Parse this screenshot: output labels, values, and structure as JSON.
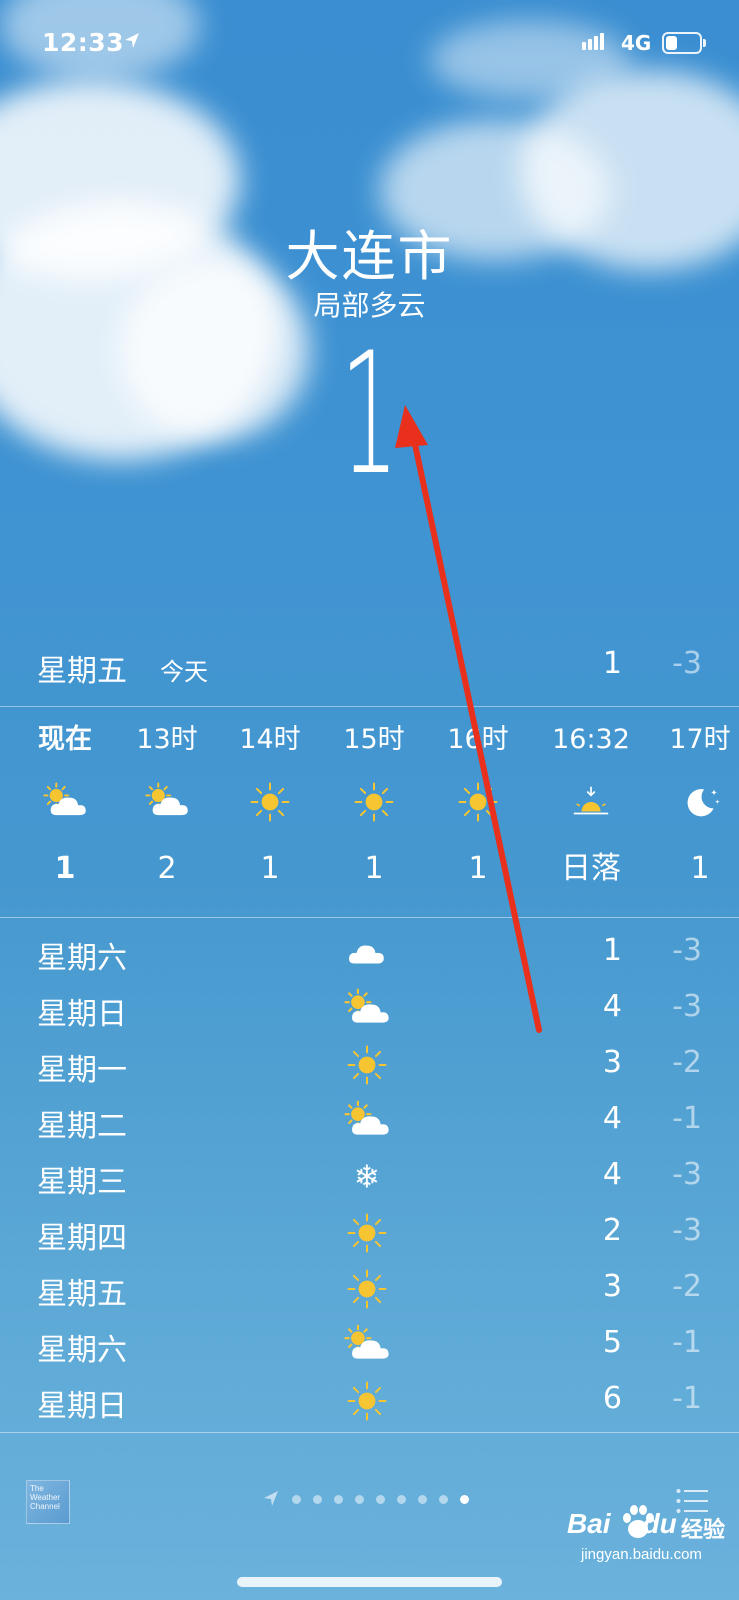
{
  "status_bar": {
    "time": "12:33",
    "network": "4G",
    "battery_level": 0.35
  },
  "location": {
    "city": "大连市",
    "condition": "局部多云",
    "temperature": "1"
  },
  "today": {
    "day": "星期五",
    "label": "今天",
    "high": "1",
    "low": "-3"
  },
  "hourly": [
    {
      "time": "现在",
      "icon": "partly-cloudy-icon",
      "temp": "1",
      "bold": true
    },
    {
      "time": "13时",
      "icon": "partly-cloudy-icon",
      "temp": "2"
    },
    {
      "time": "14时",
      "icon": "sun-icon",
      "temp": "1"
    },
    {
      "time": "15时",
      "icon": "sun-icon",
      "temp": "1"
    },
    {
      "time": "16时",
      "icon": "sun-icon",
      "temp": "1"
    },
    {
      "time": "16:32",
      "icon": "sunset-icon",
      "temp": "日落"
    },
    {
      "time": "17时",
      "icon": "moon-icon",
      "temp": "1"
    }
  ],
  "daily": [
    {
      "day": "星期六",
      "icon": "cloud-icon",
      "high": "1",
      "low": "-3"
    },
    {
      "day": "星期日",
      "icon": "partly-cloudy-icon",
      "high": "4",
      "low": "-3"
    },
    {
      "day": "星期一",
      "icon": "sun-icon",
      "high": "3",
      "low": "-2"
    },
    {
      "day": "星期二",
      "icon": "partly-cloudy-icon",
      "high": "4",
      "low": "-1"
    },
    {
      "day": "星期三",
      "icon": "snowflake-icon",
      "high": "4",
      "low": "-3"
    },
    {
      "day": "星期四",
      "icon": "sun-icon",
      "high": "2",
      "low": "-3"
    },
    {
      "day": "星期五",
      "icon": "sun-icon",
      "high": "3",
      "low": "-2"
    },
    {
      "day": "星期六",
      "icon": "partly-cloudy-icon",
      "high": "5",
      "low": "-1"
    },
    {
      "day": "星期日",
      "icon": "sun-icon",
      "high": "6",
      "low": "-1"
    }
  ],
  "footer": {
    "provider_logo_text": "The Weather Channel",
    "page_count": 9,
    "active_page": 9
  },
  "watermark": {
    "brand": "Bai",
    "brand2": "du",
    "text": "经验",
    "url": "jingyan.baidu.com"
  },
  "colors": {
    "sun": "#f7c531",
    "annotation": "#e8301c",
    "sky": "#3f93d2"
  }
}
